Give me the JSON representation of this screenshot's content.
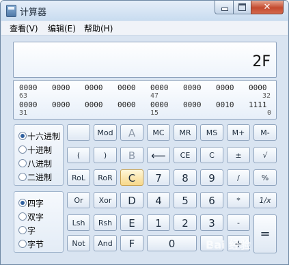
{
  "window": {
    "title": "计算器",
    "close_glyph": "✕"
  },
  "menu": [
    "查看(V)",
    "编辑(E)",
    "帮助(H)"
  ],
  "display": {
    "value": "2F"
  },
  "binary": {
    "row1": [
      "0000",
      "0000",
      "0000",
      "0000",
      "0000",
      "0000",
      "0000",
      "0000"
    ],
    "idx1": [
      "63",
      "47",
      "32"
    ],
    "row2": [
      "0000",
      "0000",
      "0000",
      "0000",
      "0000",
      "0000",
      "0010",
      "1111"
    ],
    "idx2": [
      "31",
      "15",
      "0"
    ]
  },
  "base_mode": {
    "options": [
      "十六进制",
      "十进制",
      "八进制",
      "二进制"
    ],
    "selected": "十六进制"
  },
  "word_size": {
    "options": [
      "四字",
      "双字",
      "字",
      "字节"
    ],
    "selected": "四字"
  },
  "keys": {
    "mod": "Mod",
    "A": "A",
    "MC": "MC",
    "MR": "MR",
    "MS": "MS",
    "Mplus": "M+",
    "Mminus": "M-",
    "lparen": "(",
    "rparen": ")",
    "B": "B",
    "back": "⟵",
    "CE": "CE",
    "C": "C",
    "plusminus": "±",
    "sqrt": "√",
    "RoL": "RoL",
    "RoR": "RoR",
    "Ckey": "C",
    "n7": "7",
    "n8": "8",
    "n9": "9",
    "div": "/",
    "pct": "%",
    "Or": "Or",
    "Xor": "Xor",
    "D": "D",
    "n4": "4",
    "n5": "5",
    "n6": "6",
    "mul": "*",
    "recip": "1/x",
    "Lsh": "Lsh",
    "Rsh": "Rsh",
    "E": "E",
    "n1": "1",
    "n2": "2",
    "n3": "3",
    "minus": "-",
    "eq": "=",
    "Not": "Not",
    "And": "And",
    "F": "F",
    "n0": "0",
    "dot": ".",
    "plus": "+"
  },
  "watermark": "Bai  经验"
}
